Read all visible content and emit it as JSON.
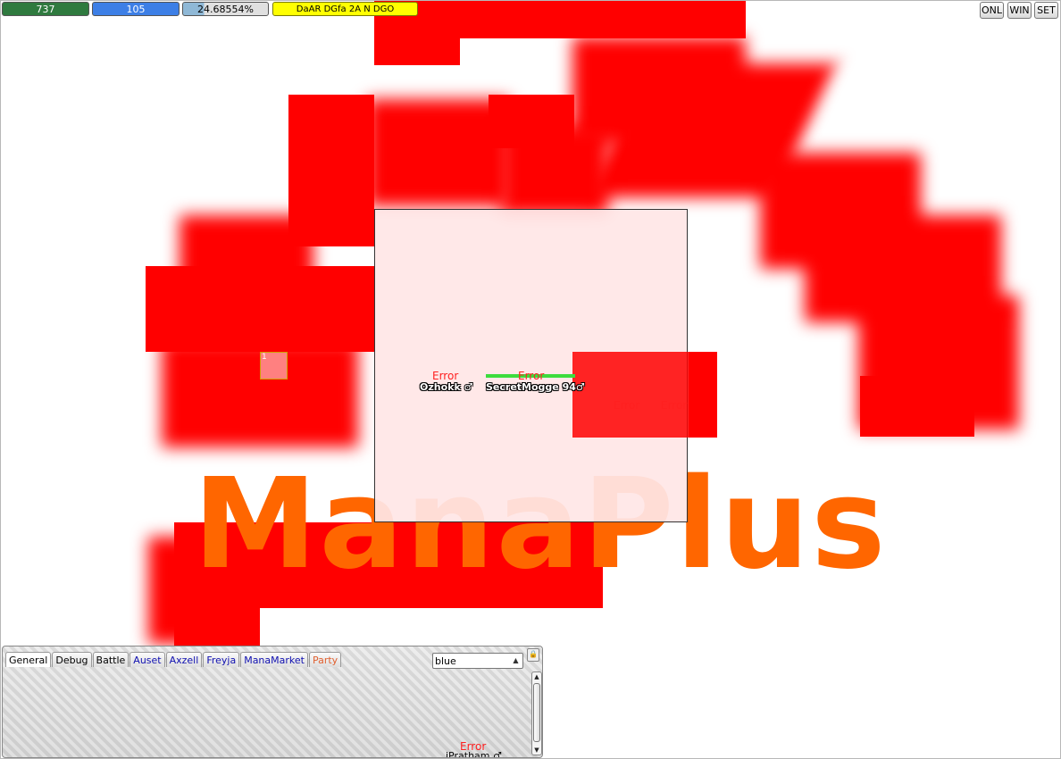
{
  "status": {
    "hp": "737",
    "mp": "105",
    "xp": "24.68554%",
    "xp_fraction": 0.2469,
    "state": "DaAR DGfa 2A N DGO"
  },
  "windows": {
    "onl": "ONL",
    "win": "WIN",
    "set": "SET"
  },
  "logo": {
    "text": "ManaPlus",
    "color": "#ff6600"
  },
  "map": {
    "tile_label": "1",
    "players": [
      {
        "error": "Error",
        "name": "Ozhokk ♂"
      },
      {
        "error": "Error",
        "name": "SecretMogge 94♂"
      }
    ],
    "extra_errors": [
      "Error",
      "Error"
    ],
    "player_hp_color": "#3ddc3d"
  },
  "chat": {
    "tabs": [
      {
        "label": "General",
        "kind": "normal"
      },
      {
        "label": "Debug",
        "kind": "normal"
      },
      {
        "label": "Battle",
        "kind": "normal"
      },
      {
        "label": "Auset",
        "kind": "whisper"
      },
      {
        "label": "Axzell",
        "kind": "whisper"
      },
      {
        "label": "Freyja",
        "kind": "whisper"
      },
      {
        "label": "ManaMarket",
        "kind": "whisper"
      },
      {
        "label": "Party",
        "kind": "party"
      }
    ],
    "input_value": "blue",
    "bottom_error": "Error",
    "bottom_name": "iPratham ♂"
  },
  "colors": {
    "error": "#ff2020",
    "blocked": "#ff0000",
    "whisper_tab": "#1010b0",
    "party_tab": "#e06030"
  }
}
